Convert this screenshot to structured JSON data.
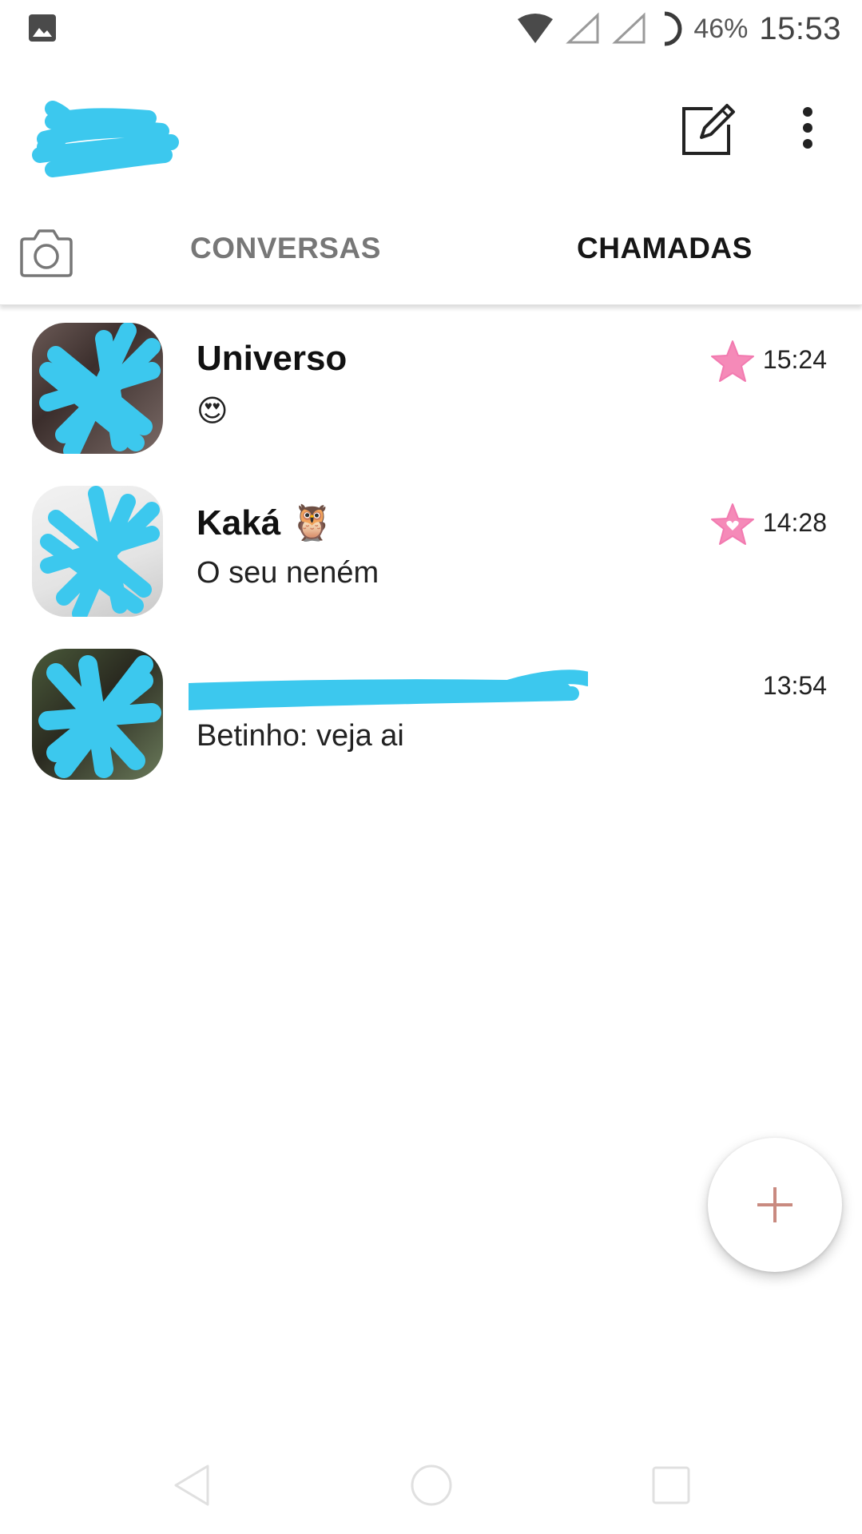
{
  "status_bar": {
    "battery_percent": "46%",
    "clock": "15:53",
    "icons": [
      "gallery-icon",
      "wifi-icon",
      "signal-icon",
      "signal-icon",
      "battery-icon"
    ]
  },
  "app_bar": {
    "icons": [
      "compose-icon",
      "more-vert-icon"
    ]
  },
  "tabs": [
    {
      "label": "CONVERSAS",
      "selected": false
    },
    {
      "label": "CHAMADAS",
      "selected": true
    }
  ],
  "chats": [
    {
      "name": "Universo",
      "preview": "😍",
      "time": "15:24",
      "pinned_icon": "star-icon"
    },
    {
      "name": "Kaká 🦉",
      "preview": "O seu neném",
      "time": "14:28",
      "pinned_icon": "star-heart-icon"
    },
    {
      "name": "",
      "preview": "Betinho: veja ai",
      "time": "13:54"
    }
  ],
  "fab": {
    "icon": "plus-icon"
  },
  "colors": {
    "accent": "#c98a80",
    "star_pink": "#f58ab8",
    "redaction_blue": "#3cc8ee"
  },
  "nav_bar": {
    "icons": [
      "back-icon",
      "home-icon",
      "recents-icon"
    ]
  }
}
